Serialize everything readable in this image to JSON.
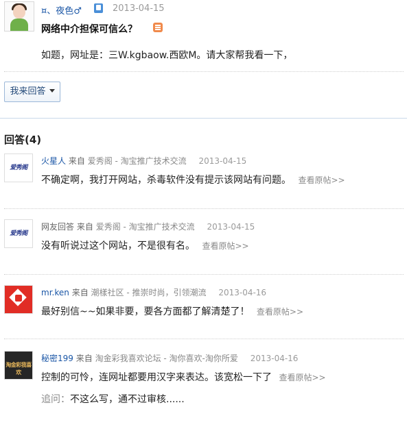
{
  "question": {
    "user": "¤、夜色♂",
    "date": "2013-04-15",
    "title": "网络中介担保可信么？",
    "body": "如题，网址是：三W.kgbaow.西欧M。请大家帮我看一下，",
    "answer_button": "我来回答"
  },
  "answers_header": "回答(4)",
  "view_link": "查看原帖>>",
  "answers": [
    {
      "name": "火星人",
      "from": "来自",
      "source": "爱秀阁 - 淘宝推广技术交流",
      "date": "2013-04-15",
      "text": "不确定啊，我打开网站，杀毒软件没有提示该网站有问题。",
      "thumb_text": "爱秀阁"
    },
    {
      "name": "网友回答",
      "from": "来自",
      "source": "爱秀阁 - 淘宝推广技术交流",
      "date": "2013-04-15",
      "text": "没有听说过这个网站，不是很有名。",
      "thumb_text": "爱秀阁"
    },
    {
      "name": "mr.ken",
      "from": "来自",
      "source": "潮樣社区 - 推崇时尚，引领潮流",
      "date": "2013-04-16",
      "text": "最好别信~~如果非要，要各方面都了解清楚了！"
    },
    {
      "name": "秘密199",
      "from": "来自",
      "source": "淘金彩我喜欢论坛 - 淘你喜欢-淘你所爱",
      "date": "2013-04-16",
      "text": "控制的可怜，连网址都要用汉字来表达。该宽松一下了",
      "thumb_text": "淘金彩我喜欢"
    }
  ],
  "followup": {
    "label": "追问：",
    "text": "不这么写，通不过审核......"
  }
}
